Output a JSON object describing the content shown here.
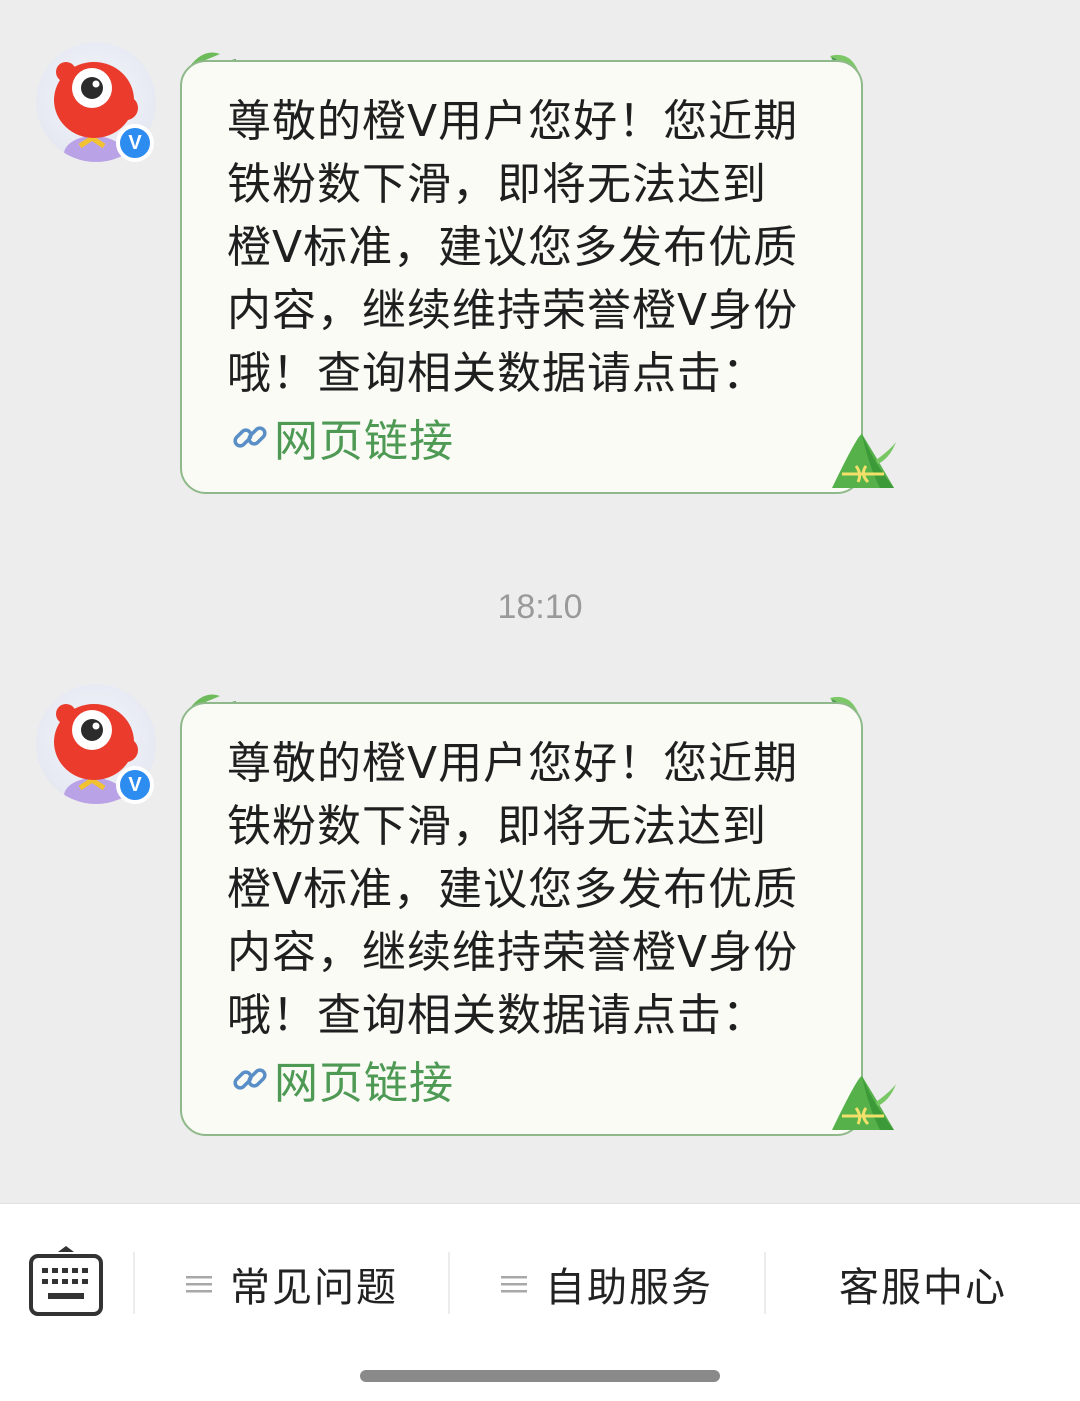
{
  "messages": [
    {
      "text": "尊敬的橙V用户您好！您近期\n铁粉数下滑，即将无法达到\n橙V标准，建议您多发布优质\n内容，继续维持荣誉橙V身份\n哦！查询相关数据请点击：",
      "link_label": "网页链接",
      "link_icon": "link-icon",
      "avatar_badge": "V"
    },
    {
      "text": "尊敬的橙V用户您好！您近期\n铁粉数下滑，即将无法达到\n橙V标准，建议您多发布优质\n内容，继续维持荣誉橙V身份\n哦！查询相关数据请点击：",
      "link_label": "网页链接",
      "link_icon": "link-icon",
      "avatar_badge": "V"
    }
  ],
  "timestamp": "18:10",
  "bottom_menu": {
    "keyboard_icon": "keyboard-icon",
    "items": [
      {
        "label": "常见问题",
        "icon": "menu-lines-icon"
      },
      {
        "label": "自助服务",
        "icon": "menu-lines-icon"
      },
      {
        "label": "客服中心"
      }
    ]
  },
  "colors": {
    "bubble_bg": "#f9fbf4",
    "bubble_border": "#8fb98a",
    "link": "#4e9a55",
    "badge": "#2d8cf0",
    "background": "#ededed"
  }
}
